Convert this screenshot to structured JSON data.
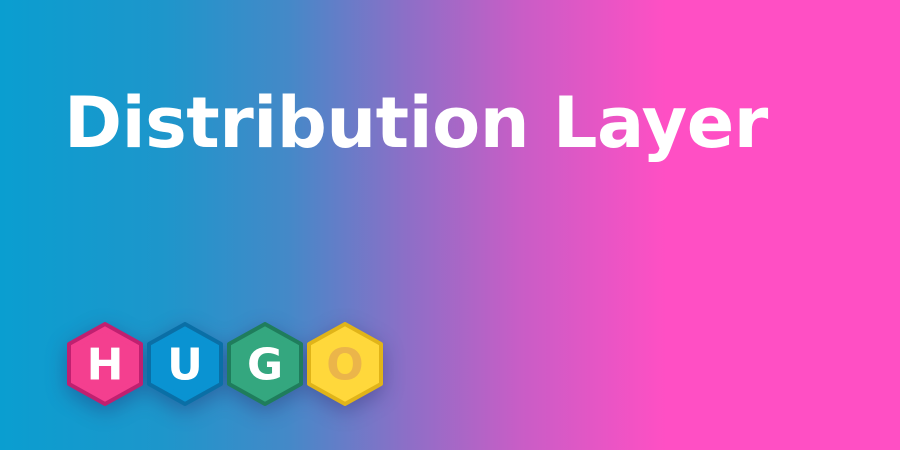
{
  "banner": {
    "title": "Distribution Layer"
  },
  "logo": {
    "letters": [
      {
        "char": "H",
        "fill": "#f43f8f",
        "rim": "#c02070",
        "text_color": "#ffffff"
      },
      {
        "char": "U",
        "fill": "#0a93d2",
        "rim": "#0a6fa6",
        "text_color": "#ffffff"
      },
      {
        "char": "G",
        "fill": "#34a77f",
        "rim": "#1f7d5c",
        "text_color": "#ffffff"
      },
      {
        "char": "O",
        "fill": "#ffd83b",
        "rim": "#e0b419",
        "text_color": "#ebb54a"
      }
    ]
  },
  "colors": {
    "gradient_left": "#0a9ed0",
    "gradient_right": "#ff4fc4",
    "title_text": "#ffffff"
  }
}
